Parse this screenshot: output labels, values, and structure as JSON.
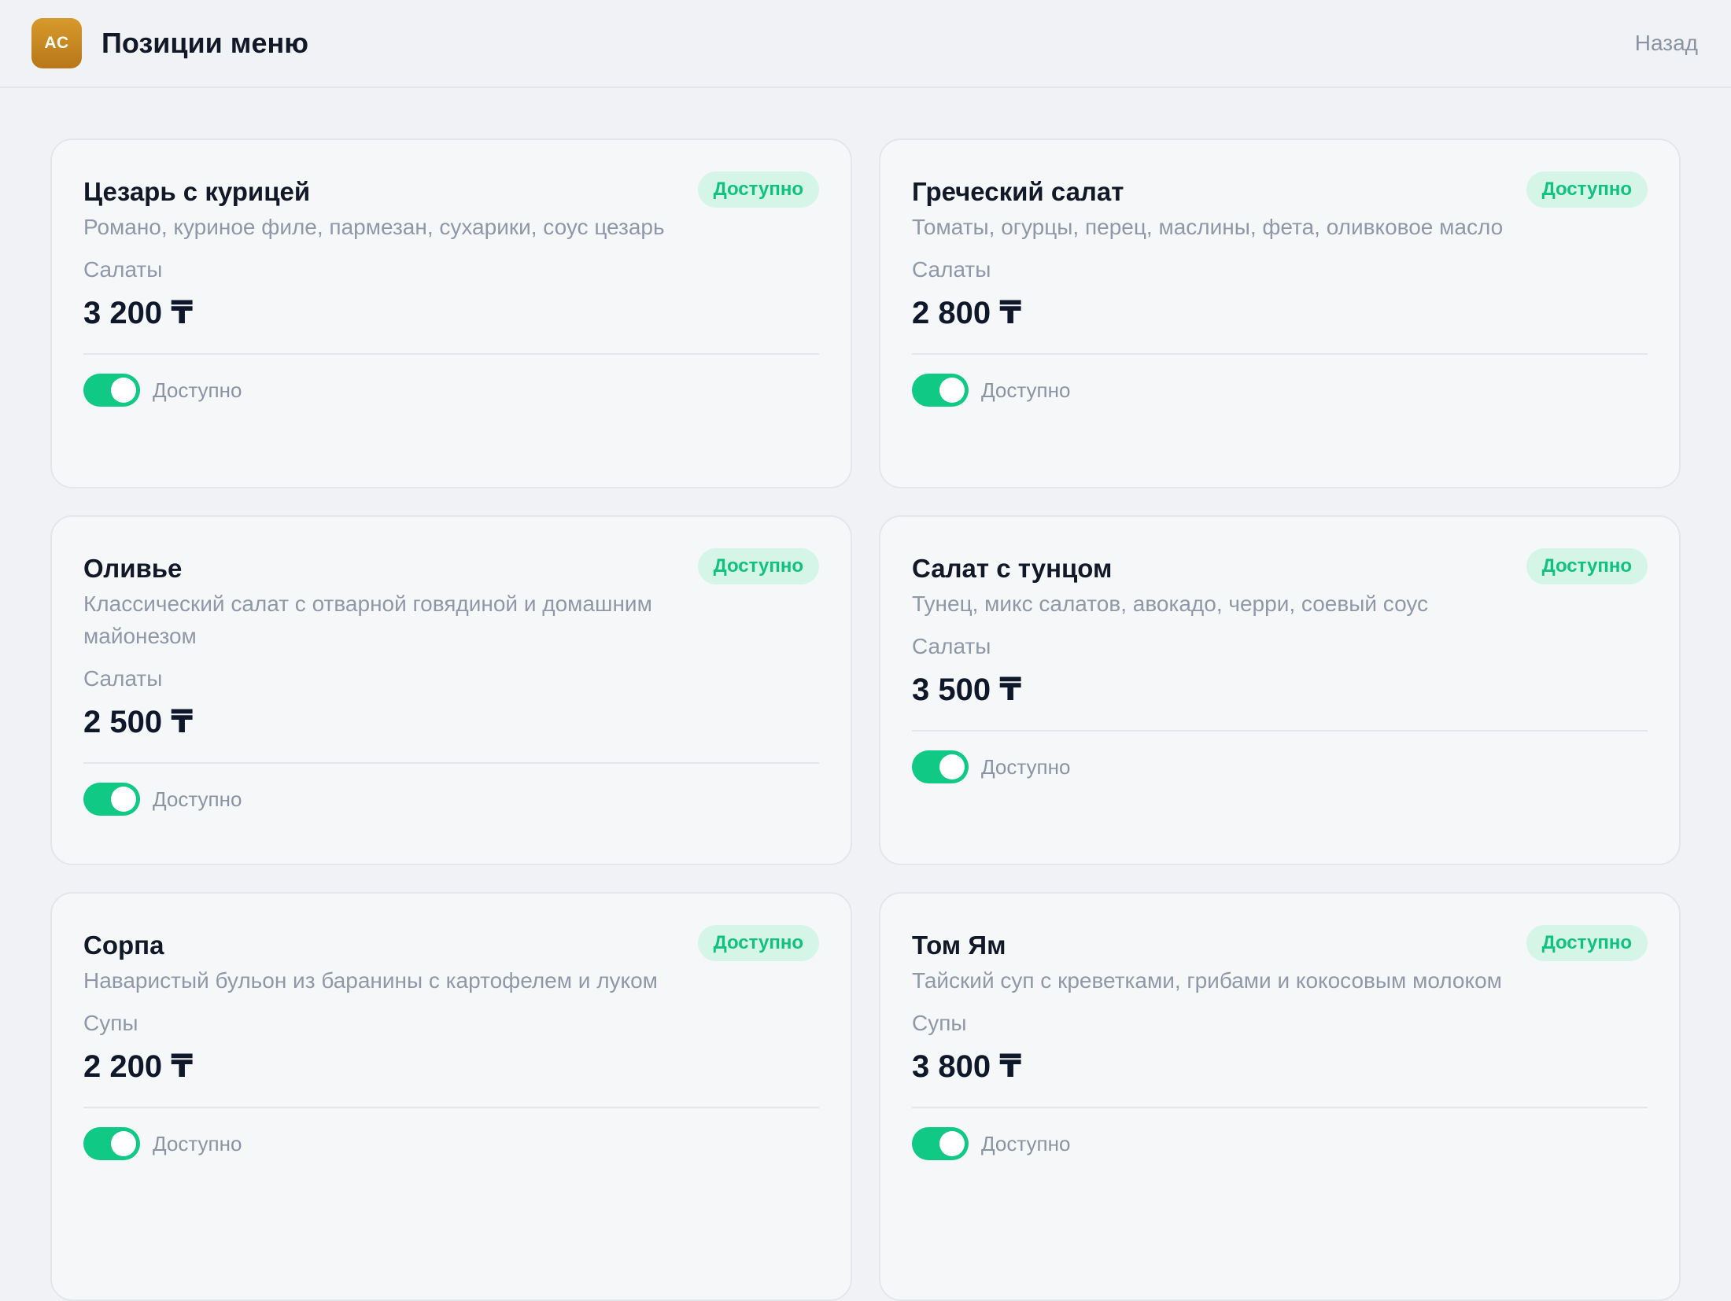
{
  "header": {
    "logo_text": "AC",
    "title": "Позиции меню",
    "back_label": "Назад"
  },
  "colors": {
    "accent_green": "#10c984",
    "badge_bg": "#d5f5e8",
    "logo_gold": "#c98a23",
    "page_bg": "#f1f2f5"
  },
  "items": [
    {
      "name": "Цезарь с курицей",
      "badge": "Доступно",
      "description": "Романо, куриное филе, пармезан, сухарики, соус цезарь",
      "category": "Салаты",
      "price": "3 200 ₸",
      "toggle_label": "Доступно",
      "available": true
    },
    {
      "name": "Греческий салат",
      "badge": "Доступно",
      "description": "Томаты, огурцы, перец, маслины, фета, оливковое масло",
      "category": "Салаты",
      "price": "2 800 ₸",
      "toggle_label": "Доступно",
      "available": true
    },
    {
      "name": "Оливье",
      "badge": "Доступно",
      "description": "Классический салат с отварной говядиной и домашним майонезом",
      "category": "Салаты",
      "price": "2 500 ₸",
      "toggle_label": "Доступно",
      "available": true
    },
    {
      "name": "Салат с тунцом",
      "badge": "Доступно",
      "description": "Тунец, микс салатов, авокадо, черри, соевый соус",
      "category": "Салаты",
      "price": "3 500 ₸",
      "toggle_label": "Доступно",
      "available": true
    },
    {
      "name": "Сорпа",
      "badge": "Доступно",
      "description": "Наваристый бульон из баранины с картофелем и луком",
      "category": "Супы",
      "price": "2 200 ₸",
      "toggle_label": "Доступно",
      "available": true
    },
    {
      "name": "Том Ям",
      "badge": "Доступно",
      "description": "Тайский суп с креветками, грибами и кокосовым молоком",
      "category": "Супы",
      "price": "3 800 ₸",
      "toggle_label": "Доступно",
      "available": true
    }
  ]
}
